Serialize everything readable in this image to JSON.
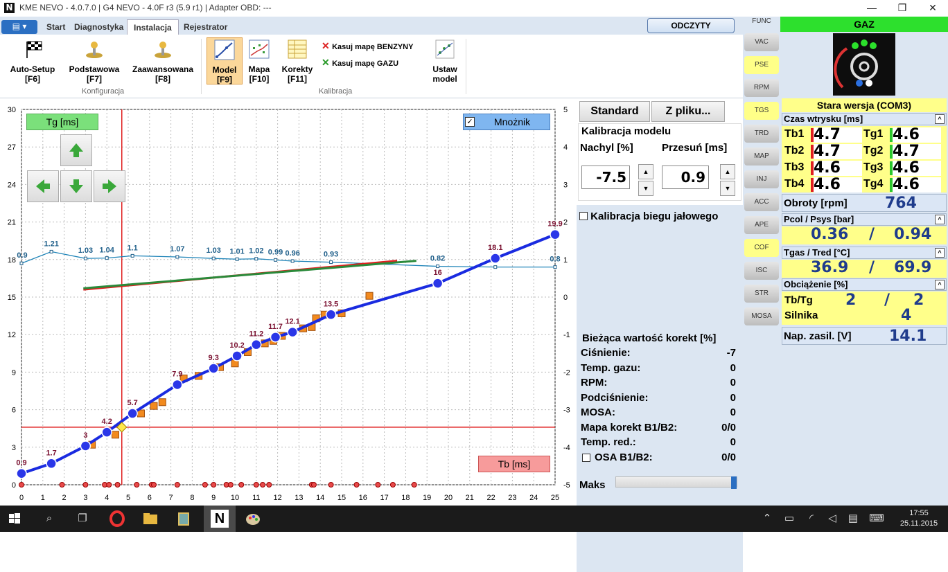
{
  "window": {
    "title": "KME NEVO - 4.0.7.0  |  G4 NEVO - 4.0F r3 (5.9 r1)  |  Adapter OBD: ---",
    "logo": "N",
    "minimize": "—",
    "restore": "❐",
    "close": "✕"
  },
  "tabs": {
    "menu": "▤ ▾",
    "items": [
      "Start",
      "Diagnostyka",
      "Instalacja",
      "Rejestrator"
    ],
    "odczyty": "ODCZYTY"
  },
  "ribbon": {
    "autosetup": [
      "Auto-Setup",
      "[F6]"
    ],
    "podstawowa": [
      "Podstawowa",
      "[F7]"
    ],
    "zaawansowana": [
      "Zaawansowana",
      "[F8]"
    ],
    "konfiguracja": "Konfiguracja",
    "model": [
      "Model",
      "[F9]"
    ],
    "mapa": [
      "Mapa",
      "[F10]"
    ],
    "korekty": [
      "Korekty",
      "[F11]"
    ],
    "kasuj_benz": "Kasuj mapę BENZYNY",
    "kasuj_gaz": "Kasuj mapę GAZU",
    "ustaw": [
      "Ustaw",
      "model"
    ],
    "kalibracja": "Kalibracja"
  },
  "chart_data": {
    "type": "scatter",
    "xlabel": "Tb [ms]",
    "ylabel": "Tg [ms]",
    "mnoznik": "Mnożnik",
    "mnoznik_checked": true,
    "x_ticks": [
      0,
      1,
      2,
      3,
      4,
      5,
      6,
      7,
      8,
      9,
      10,
      11,
      12,
      13,
      14,
      15,
      16,
      17,
      18,
      19,
      20,
      21,
      22,
      23,
      24,
      25
    ],
    "y_ticks": [
      0,
      3,
      6,
      9,
      12,
      15,
      18,
      21,
      24,
      27,
      30
    ],
    "right_ticks": [
      -5,
      -4,
      -3,
      -2,
      -1,
      0,
      1,
      2,
      3,
      4,
      5
    ],
    "xlim": [
      0,
      25
    ],
    "ylim": [
      0,
      30
    ],
    "right_lim": [
      -5,
      5
    ],
    "cursor": {
      "x": 4.7,
      "y": 4.6
    },
    "model_points": [
      {
        "x": 0,
        "y": 0.9,
        "label": "0.9"
      },
      {
        "x": 1.4,
        "y": 1.7,
        "label": "1.7"
      },
      {
        "x": 3,
        "y": 3.1,
        "label": "3"
      },
      {
        "x": 4.0,
        "y": 4.2,
        "label": "4.2"
      },
      {
        "x": 5.2,
        "y": 5.7,
        "label": "5.7"
      },
      {
        "x": 7.3,
        "y": 8.0,
        "label": "7.9"
      },
      {
        "x": 9.0,
        "y": 9.3,
        "label": "9.3"
      },
      {
        "x": 10.1,
        "y": 10.3,
        "label": "10.2"
      },
      {
        "x": 11.0,
        "y": 11.2,
        "label": "11.2"
      },
      {
        "x": 11.9,
        "y": 11.8,
        "label": "11.7"
      },
      {
        "x": 12.7,
        "y": 12.2,
        "label": "12.1"
      },
      {
        "x": 14.5,
        "y": 13.6,
        "label": "13.5"
      },
      {
        "x": 19.5,
        "y": 16.1,
        "label": "16"
      },
      {
        "x": 22.2,
        "y": 18.1,
        "label": "18.1"
      },
      {
        "x": 25,
        "y": 20.0,
        "label": "19.9"
      }
    ],
    "orange_points": [
      [
        3.3,
        3.2
      ],
      [
        4.4,
        4.0
      ],
      [
        5.6,
        5.7
      ],
      [
        6.2,
        6.3
      ],
      [
        6.6,
        6.6
      ],
      [
        7.6,
        8.5
      ],
      [
        8.3,
        8.7
      ],
      [
        9.3,
        9.4
      ],
      [
        10.0,
        9.7
      ],
      [
        10.6,
        10.6
      ],
      [
        11.4,
        11.3
      ],
      [
        11.8,
        11.5
      ],
      [
        12.2,
        11.9
      ],
      [
        13.2,
        12.5
      ],
      [
        13.6,
        12.6
      ],
      [
        13.8,
        13.3
      ],
      [
        14.2,
        13.6
      ],
      [
        15.0,
        13.7
      ],
      [
        16.3,
        15.1
      ]
    ],
    "multiplier_points": [
      {
        "x": 0,
        "v": 0.9,
        "label": "0.9"
      },
      {
        "x": 1.4,
        "v": 1.21,
        "label": "1.21"
      },
      {
        "x": 3,
        "v": 1.03,
        "label": "1.03"
      },
      {
        "x": 4.0,
        "v": 1.04,
        "label": "1.04"
      },
      {
        "x": 5.2,
        "v": 1.1,
        "label": "1.1"
      },
      {
        "x": 7.3,
        "v": 1.07,
        "label": "1.07"
      },
      {
        "x": 9.0,
        "v": 1.03,
        "label": "1.03"
      },
      {
        "x": 10.1,
        "v": 1.01,
        "label": "1.01"
      },
      {
        "x": 11.0,
        "v": 1.02,
        "label": "1.02"
      },
      {
        "x": 11.9,
        "v": 0.99,
        "label": "0.99"
      },
      {
        "x": 12.7,
        "v": 0.96,
        "label": "0.96"
      },
      {
        "x": 14.5,
        "v": 0.93,
        "label": "0.93"
      },
      {
        "x": 19.5,
        "v": 0.82,
        "label": "0.82"
      },
      {
        "x": 22.2,
        "v": 0.8,
        "label": "0.8"
      },
      {
        "x": 25,
        "v": 0.8,
        "label": "0.8"
      }
    ],
    "green_line": [
      [
        2.9,
        15.7
      ],
      [
        18.5,
        17.9
      ]
    ],
    "red_line": [
      [
        2.9,
        15.6
      ],
      [
        17.6,
        17.9
      ]
    ],
    "bottom_dots": [
      0,
      1.9,
      3.0,
      3.9,
      4.1,
      4.5,
      5.4,
      6.1,
      6.2,
      7.3,
      8.6,
      9.0,
      9.6,
      9.8,
      10.3,
      11.0,
      11.3,
      11.6,
      13.6,
      13.7,
      14.5,
      15.7,
      16.7,
      17.4,
      18.4
    ]
  },
  "panel": {
    "standard": "Standard",
    "zpliku": "Z pliku...",
    "kalibracja_modelu": "Kalibracja modelu",
    "nachyl_label": "Nachyl [%]",
    "przesun_label": "Przesuń [ms]",
    "nachyl": "-7.5",
    "przesun": "0.9",
    "up": "▲",
    "down": "▼",
    "idle_label": "Kalibracja biegu jałowego",
    "corr_title": "Bieżąca wartość korekt [%]",
    "corr_rows": [
      [
        "Ciśnienie:",
        "-7"
      ],
      [
        "Temp. gazu:",
        "0"
      ],
      [
        "RPM:",
        "0"
      ],
      [
        "Podciśnienie:",
        "0"
      ],
      [
        "MOSA:",
        "0"
      ],
      [
        "Mapa korekt B1/B2:",
        "0/0"
      ],
      [
        "Temp. red.:",
        "0"
      ],
      [
        "OSA B1/B2:",
        "0/0"
      ]
    ],
    "maks": "Maks"
  },
  "vtabs": [
    "FUNC",
    "VAC",
    "PSE",
    "RPM",
    "TGS",
    "TRD",
    "MAP",
    "INJ",
    "ACC",
    "APE",
    "COF",
    "ISC",
    "STR",
    "MOSA"
  ],
  "info": {
    "gaz": "GAZ",
    "version": "Stara wersja (COM3)",
    "czas": "Czas wtrysku [ms]",
    "tb": [
      [
        "Tb1",
        "4.7"
      ],
      [
        "Tb2",
        "4.7"
      ],
      [
        "Tb3",
        "4.6"
      ],
      [
        "Tb4",
        "4.6"
      ]
    ],
    "tg": [
      [
        "Tg1",
        "4.6"
      ],
      [
        "Tg2",
        "4.7"
      ],
      [
        "Tg3",
        "4.6"
      ],
      [
        "Tg4",
        "4.6"
      ]
    ],
    "obroty_label": "Obroty [rpm]",
    "obroty": "764",
    "pcol_label": "Pcol / Psys [bar]",
    "pcol": "0.36",
    "psys": "0.94",
    "slash": "/",
    "tgas_label": "Tgas / Tred [°C]",
    "tgas": "36.9",
    "tred": "69.9",
    "obc_label": "Obciążenie [%]",
    "tbtg_label": "Tb/Tg",
    "tbtg1": "2",
    "tbtg2": "2",
    "silnika_label": "Silnika",
    "silnika": "4",
    "nap_label": "Nap. zasil. [V]",
    "nap": "14.1",
    "collapse": "^"
  },
  "taskbar": {
    "time": "17:55",
    "date": "25.11.2015"
  }
}
